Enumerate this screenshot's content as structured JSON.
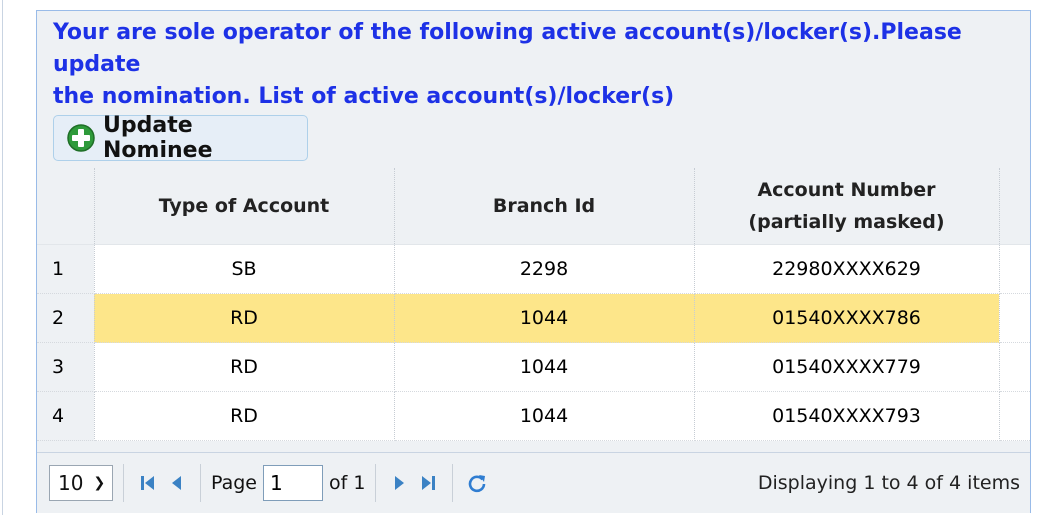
{
  "notice": {
    "line1": "Your are sole operator of the following active account(s)/locker(s).Please update",
    "line2": "the nomination. List of active account(s)/locker(s)"
  },
  "toolbar": {
    "update_nominee_label": "Update Nominee",
    "icon": "plus-circle-icon"
  },
  "grid": {
    "columns": {
      "type": "Type of Account",
      "branch": "Branch Id",
      "account_line1": "Account Number",
      "account_line2": "(partially masked)"
    },
    "rows": [
      {
        "n": "1",
        "type": "SB",
        "branch": "2298",
        "account": "22980XXXX629"
      },
      {
        "n": "2",
        "type": "RD",
        "branch": "1044",
        "account": "01540XXXX786"
      },
      {
        "n": "3",
        "type": "RD",
        "branch": "1044",
        "account": "01540XXXX779"
      },
      {
        "n": "4",
        "type": "RD",
        "branch": "1044",
        "account": "01540XXXX793"
      }
    ],
    "selected_row": 2,
    "highlight_color": "#fde68a"
  },
  "pager": {
    "page_size": "10",
    "page_label": "Page",
    "page_value": "1",
    "of_label": "of 1",
    "display_text": "Displaying 1 to 4 of 4 items"
  },
  "colors": {
    "title": "#1d31e6",
    "nav_icons": "#3b82c4",
    "refresh": "#2f7dd1"
  }
}
